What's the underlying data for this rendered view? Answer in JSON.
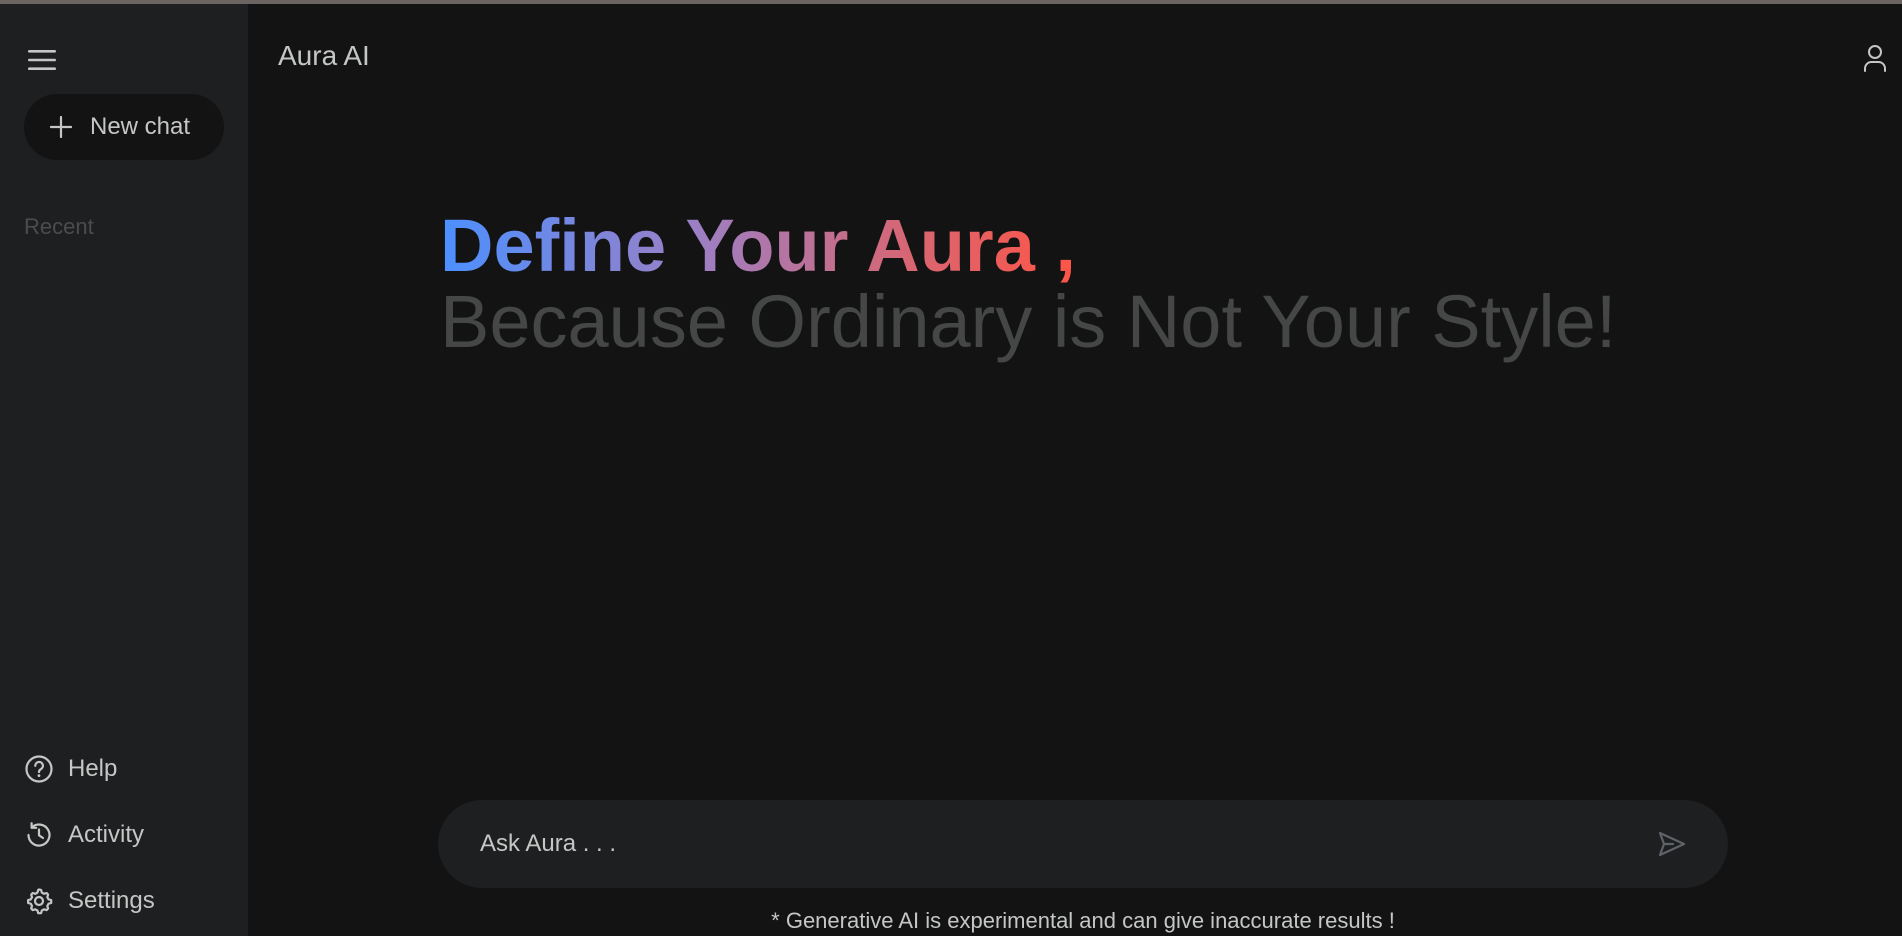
{
  "header": {
    "app_title": "Aura AI"
  },
  "sidebar": {
    "new_chat_label": "New chat",
    "recent_label": "Recent",
    "bottom_items": [
      {
        "label": "Help",
        "icon": "help-circle-icon"
      },
      {
        "label": "Activity",
        "icon": "history-icon"
      },
      {
        "label": "Settings",
        "icon": "gear-icon"
      }
    ]
  },
  "greeting": {
    "headline": "Define Your Aura ,",
    "subline": "Because Ordinary is Not Your Style!"
  },
  "prompt": {
    "placeholder": "Ask Aura . . ."
  },
  "footer": {
    "disclaimer": "* Generative AI is experimental and can give inaccurate results !"
  },
  "colors": {
    "background": "#131314",
    "sidebar": "#1e1f20",
    "text": "#c4c7c5",
    "muted": "#444746",
    "gradient_start": "#4b90ff",
    "gradient_end": "#ff5546"
  }
}
